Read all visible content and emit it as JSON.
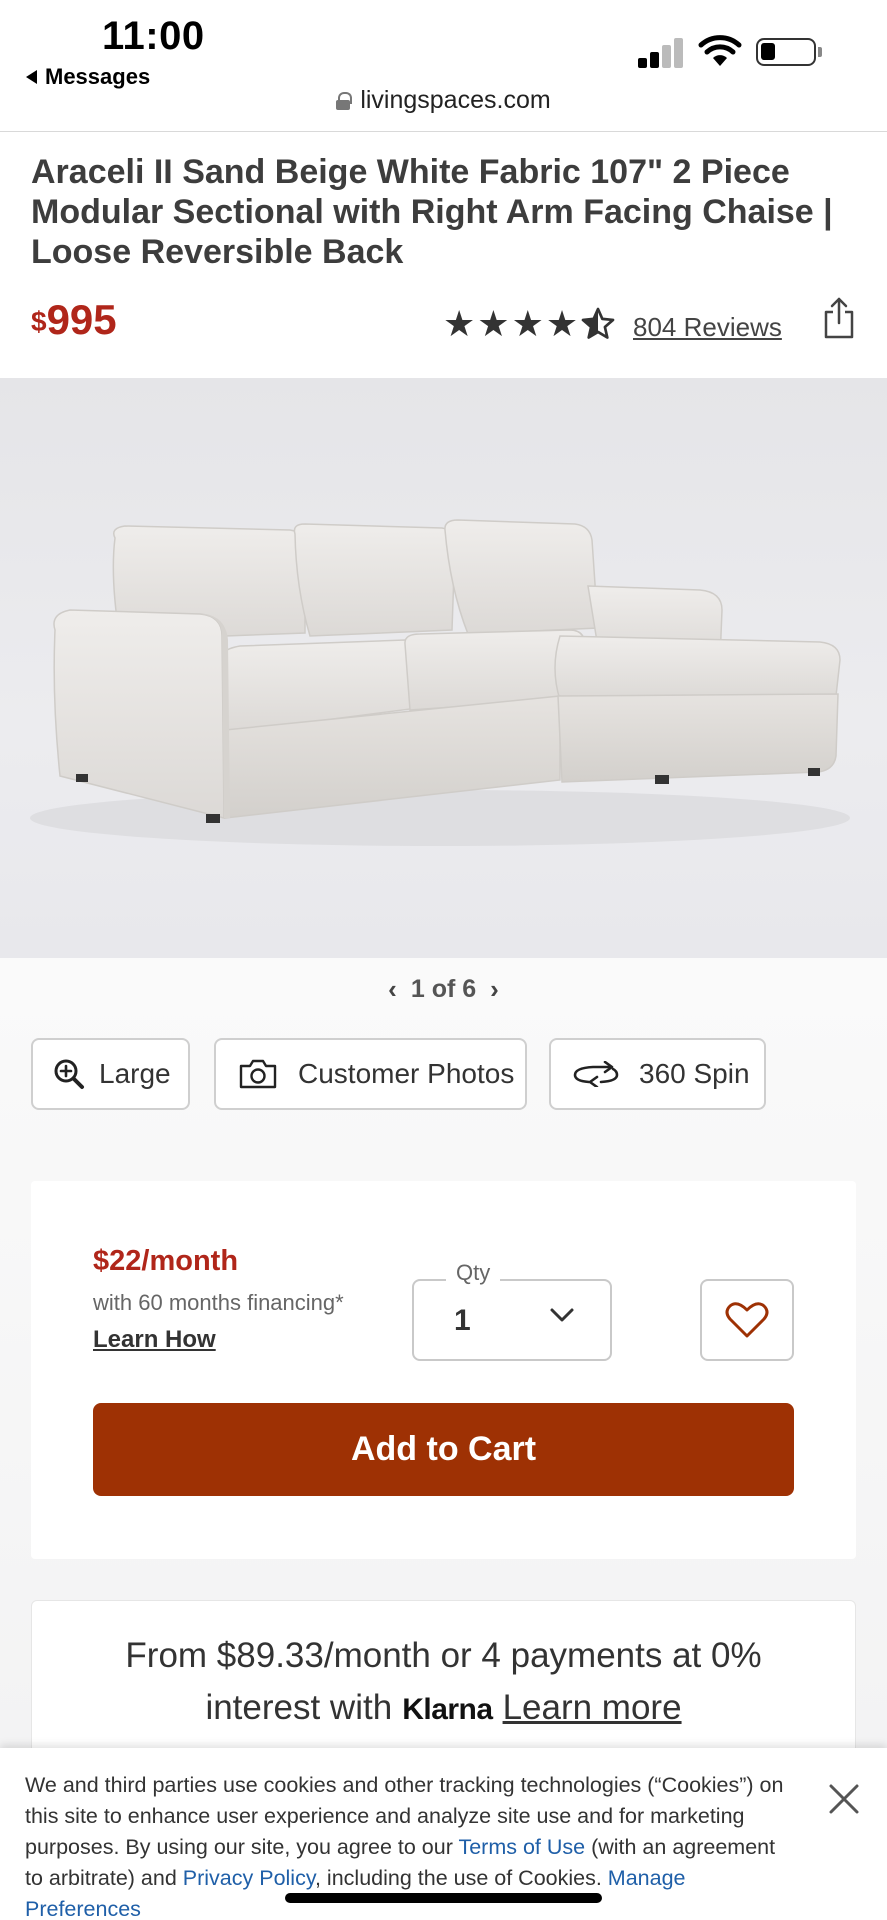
{
  "status_bar": {
    "time": "11:00",
    "back_app": "Messages",
    "url": "livingspaces.com"
  },
  "product": {
    "title": "Araceli II Sand Beige White Fabric 107\" 2 Piece Modular Sectional with Right Arm Facing Chaise | Loose Reversible Back",
    "price_currency": "$",
    "price_amount": "995",
    "rating": 4.5,
    "reviews_label": "804 Reviews"
  },
  "gallery": {
    "pager_text": "1 of 6",
    "buttons": [
      {
        "label": "Large",
        "icon": "zoom-in-icon"
      },
      {
        "label": "Customer Photos",
        "icon": "camera-icon"
      },
      {
        "label": "360 Spin",
        "icon": "spin-360-icon"
      }
    ]
  },
  "purchase": {
    "monthly": "$22/month",
    "financing_note": "with 60 months financing*",
    "learn_how": "Learn How",
    "qty_label": "Qty",
    "qty_value": "1",
    "add_to_cart": "Add to Cart"
  },
  "klarna": {
    "line1": "From $89.33/month or 4 payments at 0%",
    "line2_prefix": "interest with",
    "logo": "Klarna",
    "learn_more": "Learn more"
  },
  "cookie_banner": {
    "text_1": "We and third parties use cookies and other tracking technologies (“Cookies”) on this site to enhance user experience and analyze site use and for marketing purposes. By using our site, you agree to our ",
    "terms_link": "Terms of Use",
    "text_2": " (with an agreement to arbitrate) and ",
    "privacy_link": "Privacy Policy",
    "text_3": ", including the use of Cookies. ",
    "manage_link": "Manage Preferences"
  },
  "colors": {
    "price_red": "#b0261a",
    "cart_button": "#9e3104",
    "link_blue": "#1f5fa8"
  }
}
